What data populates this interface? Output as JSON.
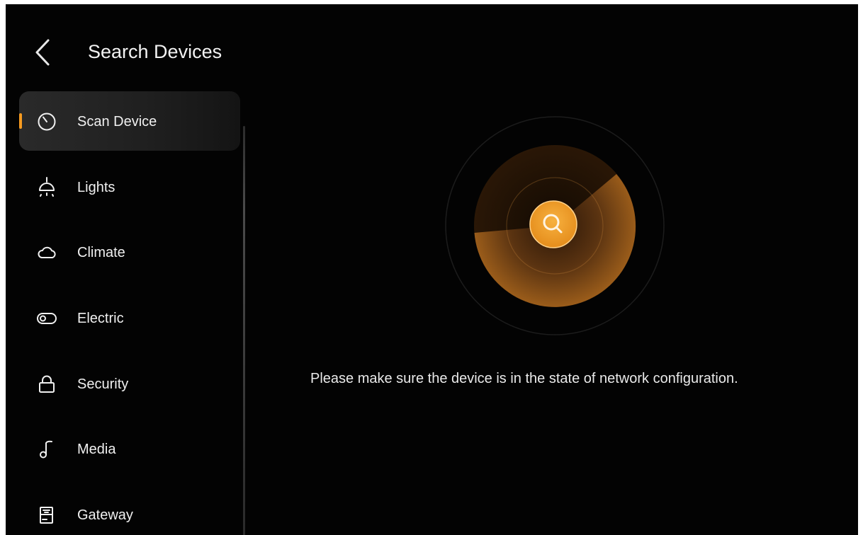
{
  "header": {
    "title": "Search Devices",
    "back_icon": "chevron-left-icon"
  },
  "sidebar": {
    "items": [
      {
        "label": "Scan Device",
        "icon": "scan-timer-icon",
        "active": true
      },
      {
        "label": "Lights",
        "icon": "ceiling-lamp-icon",
        "active": false
      },
      {
        "label": "Climate",
        "icon": "cloud-icon",
        "active": false
      },
      {
        "label": "Electric",
        "icon": "toggle-switch-icon",
        "active": false
      },
      {
        "label": "Security",
        "icon": "lock-icon",
        "active": false
      },
      {
        "label": "Media",
        "icon": "music-note-icon",
        "active": false
      },
      {
        "label": "Gateway",
        "icon": "router-icon",
        "active": false
      }
    ]
  },
  "main": {
    "radar_icon": "radar-sweep-icon",
    "search_icon": "search-icon",
    "hint": "Please make sure the device is in the state of network configuration."
  },
  "colors": {
    "background": "#030303",
    "accent": "#f59a20",
    "text": "#f0f0f0"
  }
}
